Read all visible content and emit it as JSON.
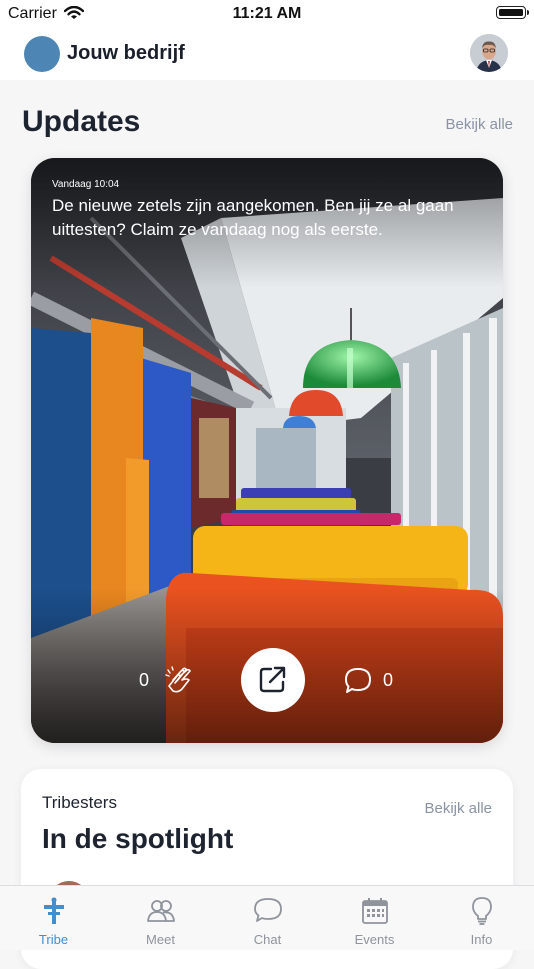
{
  "status_bar": {
    "carrier": "Carrier",
    "time": "11:21 AM"
  },
  "header": {
    "company_name": "Jouw bedrijf"
  },
  "updates": {
    "title": "Updates",
    "see_all": "Bekijk alle",
    "post": {
      "date": "Vandaag 10:04",
      "text": "De nieuwe zetels zijn aangekomen. Ben jij ze al gaan uittesten? Claim ze vandaag nog als eerste.",
      "claps": "0",
      "comments": "0"
    }
  },
  "spotlight": {
    "subtitle": "Tribesters",
    "title": "In de spotlight",
    "see_all": "Bekijk alle"
  },
  "tabs": [
    {
      "label": "Tribe",
      "icon": "tribe-icon",
      "active": true
    },
    {
      "label": "Meet",
      "icon": "people-icon",
      "active": false
    },
    {
      "label": "Chat",
      "icon": "chat-bubble-icon",
      "active": false
    },
    {
      "label": "Events",
      "icon": "calendar-icon",
      "active": false
    },
    {
      "label": "Info",
      "icon": "lightbulb-icon",
      "active": false
    }
  ],
  "colors": {
    "accent": "#3f8fd2",
    "logo": "#4d86b5",
    "muted": "#8a93a3"
  }
}
